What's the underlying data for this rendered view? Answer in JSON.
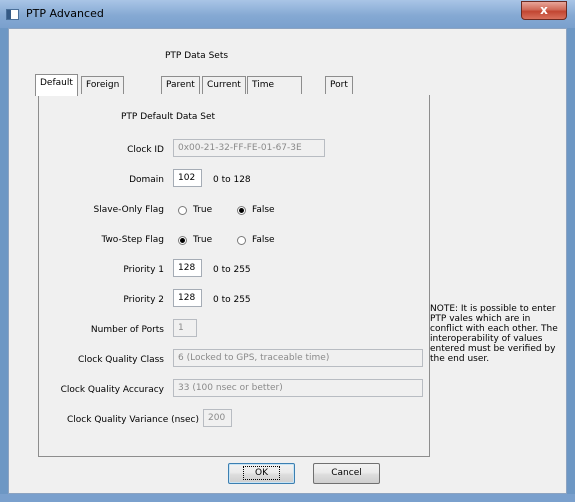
{
  "window": {
    "title": "PTP Advanced",
    "close_glyph": "x"
  },
  "heading": "PTP Data Sets",
  "tabs": [
    "Default",
    "Foreign Master",
    "Parent",
    "Current",
    "Time Properties",
    "Port"
  ],
  "active_tab": "Default",
  "panel_title": "PTP Default Data Set",
  "fields": {
    "clock_id": {
      "label": "Clock ID",
      "value": "0x00-21-32-FF-FE-01-67-3E"
    },
    "domain": {
      "label": "Domain",
      "value": "102",
      "range": "0 to 128"
    },
    "slave_only": {
      "label": "Slave-Only Flag",
      "true_label": "True",
      "false_label": "False",
      "selected": "False"
    },
    "two_step": {
      "label": "Two-Step Flag",
      "true_label": "True",
      "false_label": "False",
      "selected": "True"
    },
    "priority1": {
      "label": "Priority 1",
      "value": "128",
      "range": "0 to 255"
    },
    "priority2": {
      "label": "Priority 2",
      "value": "128",
      "range": "0 to 255"
    },
    "num_ports": {
      "label": "Number of Ports",
      "value": "1"
    },
    "clock_quality_class": {
      "label": "Clock Quality Class",
      "value": "6 (Locked to GPS, traceable time)"
    },
    "clock_quality_accuracy": {
      "label": "Clock Quality Accuracy",
      "value": "33 (100 nsec or better)"
    },
    "clock_quality_variance": {
      "label": "Clock Quality Variance (nsec)",
      "value": "200"
    }
  },
  "note": "NOTE: It is possible to enter PTP vales which are in conflict with each other. The interoperability of values entered must be verified by the end user.",
  "buttons": {
    "ok": "OK",
    "cancel": "Cancel"
  }
}
